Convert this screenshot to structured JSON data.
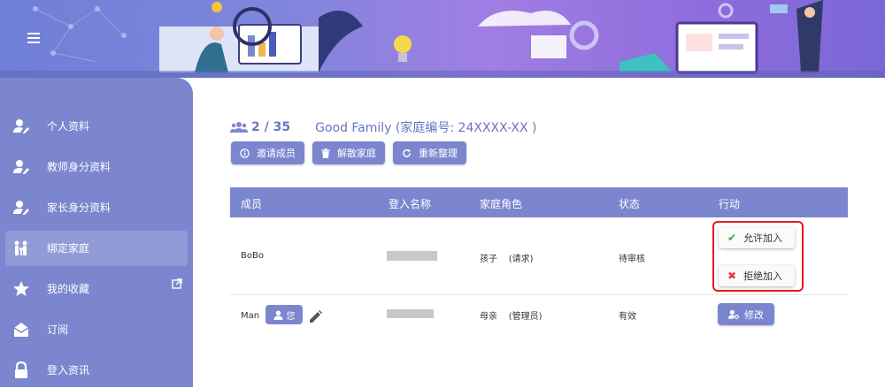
{
  "colors": {
    "primary": "#7b86cf",
    "primary_text": "#6a74c3",
    "highlight": "#e01b1b",
    "approve": "#43a047",
    "reject": "#e53935"
  },
  "banner": {
    "menu_icon": "hamburger-menu-icon"
  },
  "sidebar": {
    "items": [
      {
        "label": "个人资料",
        "icon": "user-edit-icon",
        "active": false
      },
      {
        "label": "教师身分资料",
        "icon": "user-edit-icon",
        "active": false
      },
      {
        "label": "家长身分资料",
        "icon": "user-edit-icon",
        "active": false
      },
      {
        "label": "绑定家庭",
        "icon": "family-icon",
        "active": true
      },
      {
        "label": "我的收藏",
        "icon": "star-icon",
        "active": false,
        "external_icon": "external-link-icon"
      },
      {
        "label": "订阅",
        "icon": "envelope-open-icon",
        "active": false
      },
      {
        "label": "登入资讯",
        "icon": "lock-icon",
        "active": false
      }
    ]
  },
  "family": {
    "members_icon": "users-icon",
    "count": "2 / 35",
    "name": "Good Family (家庭编号: 24XXXX-XX )"
  },
  "actions": {
    "invite": "邀请成员",
    "dissolve": "解散家庭",
    "reorganize": "重新整理"
  },
  "table": {
    "headers": [
      "成员",
      "登入名称",
      "家庭角色",
      "状态",
      "行动"
    ],
    "rows": [
      {
        "member": "BoBo",
        "role": "孩子",
        "role_note": "(请求)",
        "status": "待审核",
        "approve": "允许加入",
        "reject": "拒绝加入"
      },
      {
        "member": "Man",
        "you": "您",
        "role": "母亲",
        "role_note": "(管理员)",
        "status": "有效",
        "edit": "修改"
      }
    ]
  }
}
